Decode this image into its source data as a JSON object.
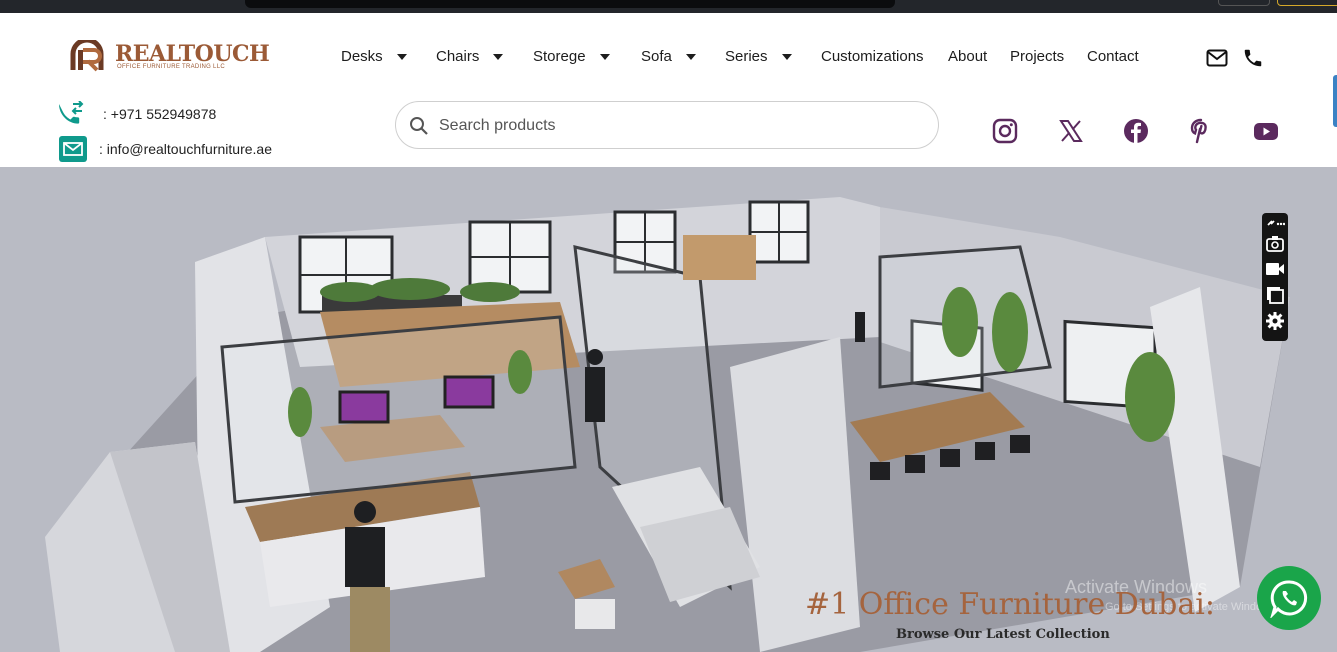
{
  "brand": {
    "name": "REALTOUCH",
    "tagline": "OFFICE FURNITURE TRADING LLC",
    "color": "#9b5a36"
  },
  "nav": {
    "items": [
      {
        "label": "Desks",
        "dropdown": true
      },
      {
        "label": "Chairs",
        "dropdown": true
      },
      {
        "label": "Storege",
        "dropdown": true
      },
      {
        "label": "Sofa",
        "dropdown": true
      },
      {
        "label": "Series",
        "dropdown": true
      },
      {
        "label": "Customizations",
        "dropdown": false
      },
      {
        "label": "About",
        "dropdown": false
      },
      {
        "label": "Projects",
        "dropdown": false
      },
      {
        "label": "Contact",
        "dropdown": false
      }
    ]
  },
  "header_icons": [
    "envelope-icon",
    "phone-icon"
  ],
  "contact": {
    "phone": ": +971 552949878",
    "email": ": info@realtouchfurniture.ae",
    "icon_color": "#0f9a8c"
  },
  "search": {
    "placeholder": "Search products",
    "value": ""
  },
  "social": {
    "icons": [
      "instagram-icon",
      "x-icon",
      "facebook-icon",
      "pinterest-icon",
      "youtube-icon"
    ],
    "color": "#5b2a5e"
  },
  "hero": {
    "title": "#1 Office Furniture Dubai:",
    "subtitle": "Browse Our Latest Collection",
    "image_subject": "3D rendering of an office interior"
  },
  "watermark": {
    "line1": "Activate Windows",
    "line2": "Go to Settings to activate Windows."
  },
  "floating_toolbar": {
    "icons": [
      "link-icon",
      "camera-icon",
      "video-icon",
      "copy-icon",
      "gear-icon"
    ]
  },
  "whatsapp": {
    "icon": "whatsapp-icon",
    "color": "#1aa54a"
  }
}
